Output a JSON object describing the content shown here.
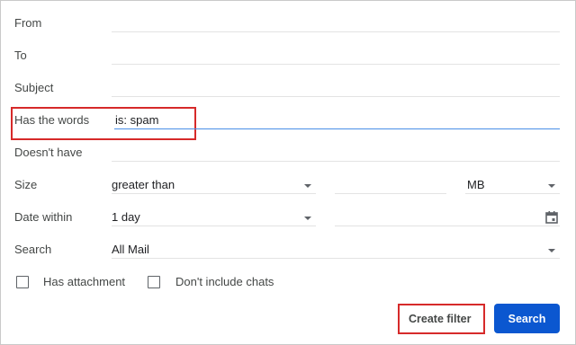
{
  "fields": {
    "from_label": "From",
    "to_label": "To",
    "subject_label": "Subject",
    "has_words_label": "Has the words",
    "has_words_value": "is: spam",
    "doesnt_have_label": "Doesn't have",
    "size_label": "Size",
    "size_operator": "greater than",
    "size_unit": "MB",
    "date_within_label": "Date within",
    "date_within_value": "1 day",
    "search_label": "Search",
    "search_value": "All Mail"
  },
  "checkboxes": {
    "has_attachment": "Has attachment",
    "dont_include_chats": "Don't include chats"
  },
  "buttons": {
    "create_filter": "Create filter",
    "search": "Search"
  },
  "colors": {
    "highlight": "#d62a2a",
    "primary": "#0b57d0",
    "active_underline": "#4a8fe7"
  }
}
